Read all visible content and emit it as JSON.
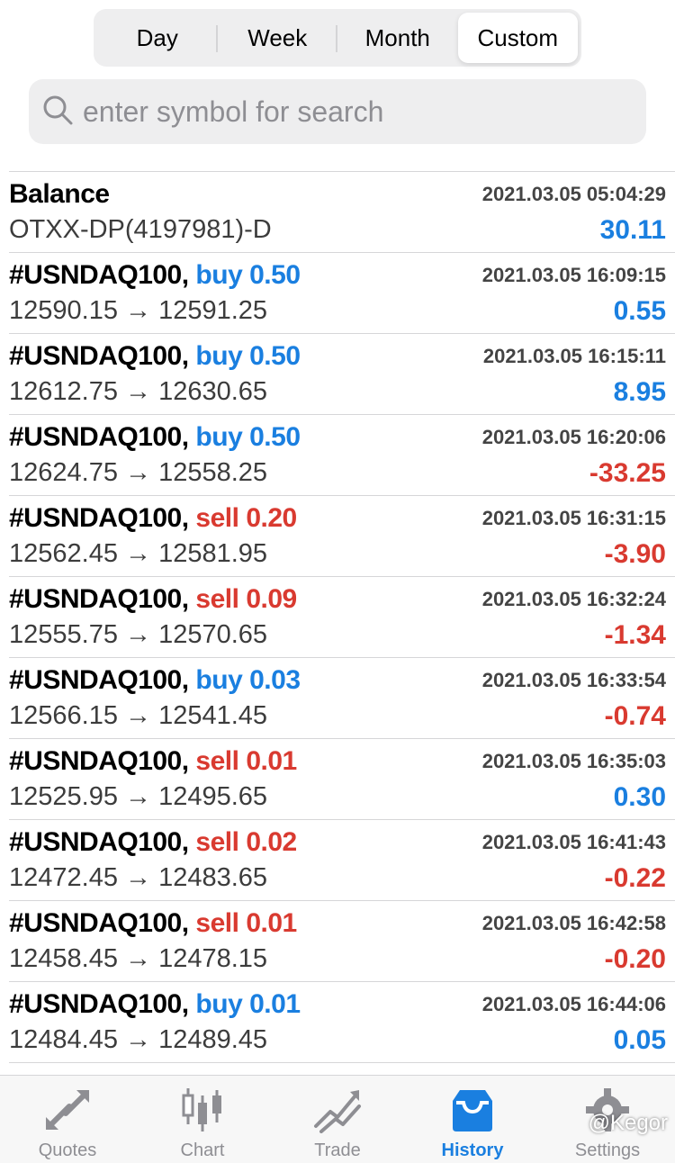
{
  "period_tabs": [
    "Day",
    "Week",
    "Month",
    "Custom"
  ],
  "active_tab": "Custom",
  "search": {
    "placeholder": "enter symbol for search"
  },
  "deals": [
    {
      "title": "Balance",
      "side": "",
      "volume": "",
      "time": "2021.03.05 05:04:29",
      "detail": "OTXX-DP(4197981)-D",
      "profit": "30.11",
      "profit_sign": "pos"
    },
    {
      "title": "#USNDAQ100,",
      "side": "buy",
      "volume": "0.50",
      "time": "2021.03.05 16:09:15",
      "detail": "12590.15 → 12591.25",
      "profit": "0.55",
      "profit_sign": "pos"
    },
    {
      "title": "#USNDAQ100,",
      "side": "buy",
      "volume": "0.50",
      "time": "2021.03.05 16:15:11",
      "detail": "12612.75 → 12630.65",
      "profit": "8.95",
      "profit_sign": "pos"
    },
    {
      "title": "#USNDAQ100,",
      "side": "buy",
      "volume": "0.50",
      "time": "2021.03.05 16:20:06",
      "detail": "12624.75 → 12558.25",
      "profit": "-33.25",
      "profit_sign": "neg"
    },
    {
      "title": "#USNDAQ100,",
      "side": "sell",
      "volume": "0.20",
      "time": "2021.03.05 16:31:15",
      "detail": "12562.45 → 12581.95",
      "profit": "-3.90",
      "profit_sign": "neg"
    },
    {
      "title": "#USNDAQ100,",
      "side": "sell",
      "volume": "0.09",
      "time": "2021.03.05 16:32:24",
      "detail": "12555.75 → 12570.65",
      "profit": "-1.34",
      "profit_sign": "neg"
    },
    {
      "title": "#USNDAQ100,",
      "side": "buy",
      "volume": "0.03",
      "time": "2021.03.05 16:33:54",
      "detail": "12566.15 → 12541.45",
      "profit": "-0.74",
      "profit_sign": "neg"
    },
    {
      "title": "#USNDAQ100,",
      "side": "sell",
      "volume": "0.01",
      "time": "2021.03.05 16:35:03",
      "detail": "12525.95 → 12495.65",
      "profit": "0.30",
      "profit_sign": "pos"
    },
    {
      "title": "#USNDAQ100,",
      "side": "sell",
      "volume": "0.02",
      "time": "2021.03.05 16:41:43",
      "detail": "12472.45 → 12483.65",
      "profit": "-0.22",
      "profit_sign": "neg"
    },
    {
      "title": "#USNDAQ100,",
      "side": "sell",
      "volume": "0.01",
      "time": "2021.03.05 16:42:58",
      "detail": "12458.45 → 12478.15",
      "profit": "-0.20",
      "profit_sign": "neg"
    },
    {
      "title": "#USNDAQ100,",
      "side": "buy",
      "volume": "0.01",
      "time": "2021.03.05 16:44:06",
      "detail": "12484.45 → 12489.45",
      "profit": "0.05",
      "profit_sign": "pos"
    }
  ],
  "tabbar": [
    {
      "label": "Quotes",
      "icon": "quotes-icon"
    },
    {
      "label": "Chart",
      "icon": "chart-icon"
    },
    {
      "label": "Trade",
      "icon": "trade-icon"
    },
    {
      "label": "History",
      "icon": "history-icon"
    },
    {
      "label": "Settings",
      "icon": "settings-icon"
    }
  ],
  "active_nav": "History",
  "watermark": "@Kegor",
  "colors": {
    "accent": "#1a7fe0",
    "loss": "#d93a30",
    "muted": "#8e8e93"
  }
}
